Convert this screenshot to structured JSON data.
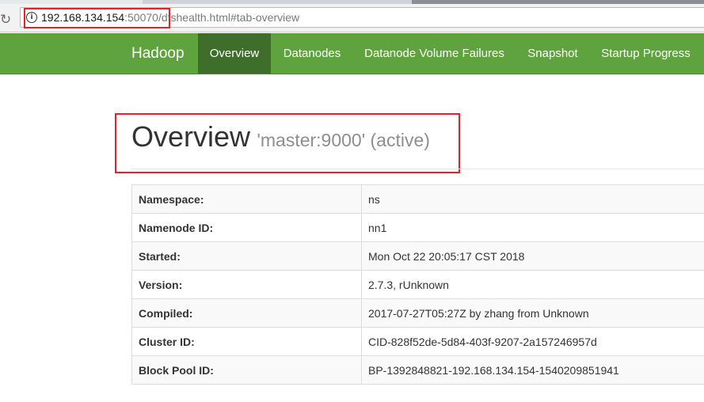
{
  "browser": {
    "url_host": "192.168.134.154",
    "url_port": ":50070",
    "url_path": "/dfshealth.html#tab-overview"
  },
  "navbar": {
    "brand": "Hadoop",
    "items": [
      {
        "label": "Overview",
        "active": true
      },
      {
        "label": "Datanodes",
        "active": false
      },
      {
        "label": "Datanode Volume Failures",
        "active": false
      },
      {
        "label": "Snapshot",
        "active": false
      },
      {
        "label": "Startup Progress",
        "active": false
      }
    ]
  },
  "page": {
    "title": "Overview",
    "subtitle": "'master:9000' (active)"
  },
  "overview_table": [
    {
      "key": "Namespace:",
      "value": "ns"
    },
    {
      "key": "Namenode ID:",
      "value": "nn1"
    },
    {
      "key": "Started:",
      "value": "Mon Oct 22 20:05:17 CST 2018"
    },
    {
      "key": "Version:",
      "value": "2.7.3, rUnknown"
    },
    {
      "key": "Compiled:",
      "value": "2017-07-27T05:27Z by zhang from Unknown"
    },
    {
      "key": "Cluster ID:",
      "value": "CID-828f52de-5d84-403f-9207-2a157246957d"
    },
    {
      "key": "Block Pool ID:",
      "value": "BP-1392848821-192.168.134.154-1540209851941"
    }
  ],
  "colors": {
    "navbar": "#5fa33e",
    "navbar_active": "#3f6e2a",
    "highlight_box": "#e0242a"
  }
}
